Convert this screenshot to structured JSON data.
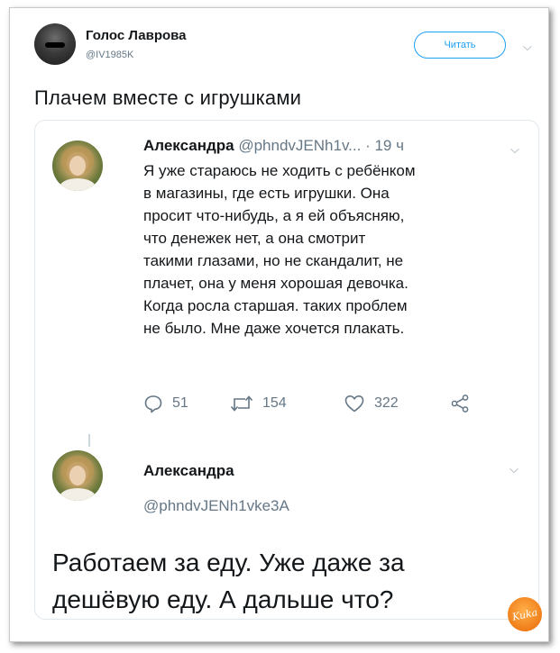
{
  "tweet": {
    "author_name": "Голос Лаврова",
    "author_handle": "@IV1985K",
    "follow_label": "Читать",
    "text": "Плачем вместе с игрушками"
  },
  "quoted": {
    "name": "Александра",
    "handle": "@phndvJENh1v...",
    "time": "· 19 ч",
    "lines": [
      "Я уже стараюсь не ходить с ребёнком",
      "в магазины, где есть игрушки. Она",
      "просит что-нибудь, а я ей объясняю,",
      "что денежек нет, а она смотрит",
      "такими глазами, но не скандалит, не",
      "плачет, она у меня хорошая девочка.",
      "Когда росла старшая. таких проблем",
      "не было. Мне даже хочется плакать."
    ],
    "replies": "51",
    "retweets": "154",
    "likes": "322"
  },
  "reply": {
    "name": "Александра",
    "handle": "@phndvJENh1vke3A",
    "lines": [
      "Работаем за еду. Уже даже за",
      "дешёвую еду. А дальше что?"
    ]
  },
  "watermark": "Kuka",
  "icons": {
    "more": "chevron-down-icon",
    "reply": "reply-icon",
    "retweet": "retweet-icon",
    "like": "heart-icon",
    "share": "share-icon"
  },
  "colors": {
    "accent": "#1da1f2",
    "secondary_text": "#657786",
    "text": "#14171a",
    "border": "#e1e8ed"
  }
}
